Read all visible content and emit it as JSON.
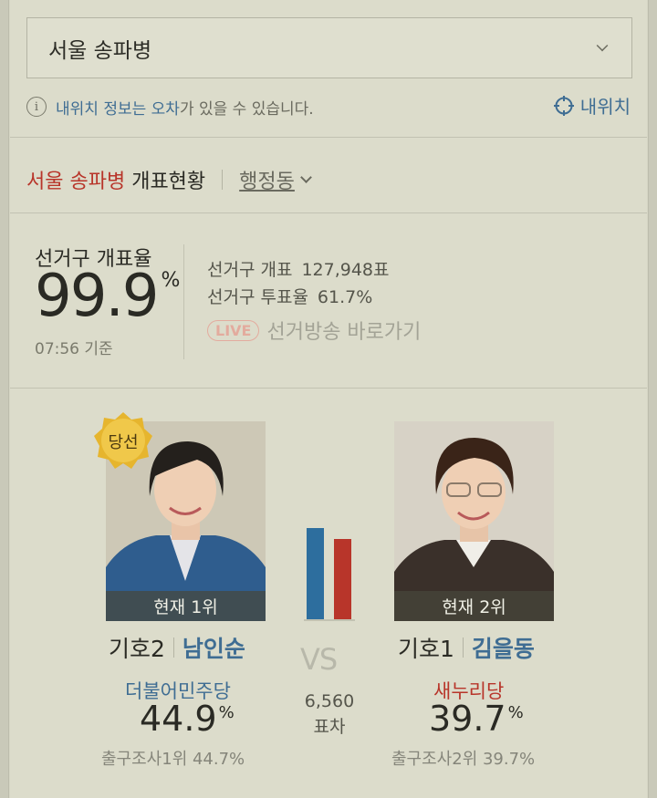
{
  "region_select": {
    "value": "서울 송파병"
  },
  "notice": {
    "link_text": "내위치 정보는 오차",
    "rest_text": "가 있을 수 있습니다."
  },
  "my_location": {
    "label": "내위치"
  },
  "heading": {
    "district": "서울 송파병",
    "title": "개표현황",
    "dong_label": "행정동"
  },
  "counting": {
    "label": "선거구 개표율",
    "rate": "99.9",
    "unit": "%",
    "time": "07:56 기준",
    "votes_label": "선거구 개표",
    "votes_value": "127,948표",
    "turnout_label": "선거구 투표율",
    "turnout_value": "61.7%",
    "live_badge": "LIVE",
    "live_link": "선거방송 바로가기"
  },
  "vs": {
    "text": "VS",
    "margin_value": "6,560",
    "margin_label": "표차"
  },
  "candidates": [
    {
      "rank_label": "현재 1위",
      "number": "기호2",
      "name": "남인순",
      "party": "더불어민주당",
      "party_color": "#3f6d93",
      "rate": "44.9",
      "unit": "%",
      "exit_poll": "출구조사1위 44.7%",
      "elected_badge": "당선",
      "bar_color": "#2d6e9e",
      "vote_share": 44.9
    },
    {
      "rank_label": "현재 2위",
      "number": "기호1",
      "name": "김을동",
      "party": "새누리당",
      "party_color": "#b8352a",
      "rate": "39.7",
      "unit": "%",
      "exit_poll": "출구조사2위 39.7%",
      "bar_color": "#b8352a",
      "vote_share": 39.7
    }
  ]
}
